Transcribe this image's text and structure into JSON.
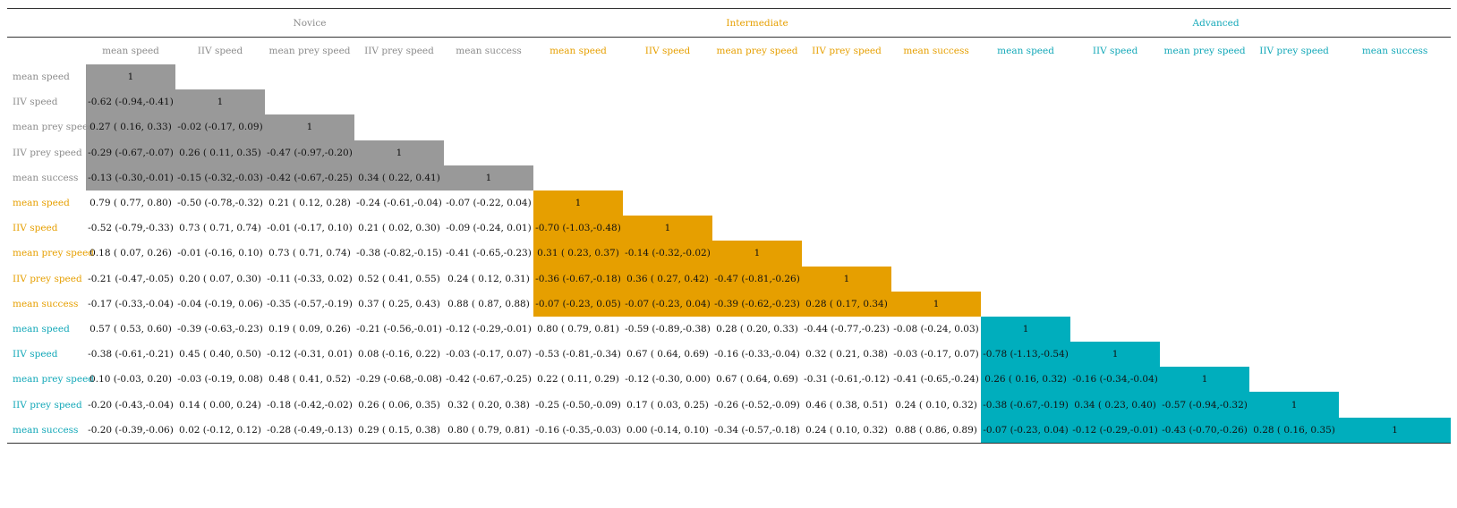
{
  "colors": {
    "novice": "#8c8c8c",
    "intermediate": "#e69f00",
    "advanced": "#13a8b8",
    "novice_bg": "#999999",
    "intermediate_bg": "#e69f00",
    "advanced_bg": "#00aebd"
  },
  "groups": [
    "Novice",
    "Intermediate",
    "Advanced"
  ],
  "columns": [
    [
      "mean speed",
      "IIV speed",
      "mean prey speed",
      "IIV prey speed",
      "mean success"
    ],
    [
      "mean speed",
      "IIV speed",
      "mean prey speed",
      "IIV prey speed",
      "mean success"
    ],
    [
      "mean speed",
      "IIV speed",
      "mean prey speed",
      "IIV prey speed",
      "mean success"
    ]
  ],
  "rows": [
    {
      "group": 0,
      "label": "mean speed",
      "cells": [
        "1"
      ]
    },
    {
      "group": 0,
      "label": "IIV speed",
      "cells": [
        "-0.62 (-0.94,-0.41)",
        "1"
      ]
    },
    {
      "group": 0,
      "label": "mean prey speed",
      "cells": [
        "0.27 ( 0.16, 0.33)",
        "-0.02 (-0.17, 0.09)",
        "1"
      ]
    },
    {
      "group": 0,
      "label": "IIV prey speed",
      "cells": [
        "-0.29 (-0.67,-0.07)",
        "0.26 ( 0.11, 0.35)",
        "-0.47 (-0.97,-0.20)",
        "1"
      ]
    },
    {
      "group": 0,
      "label": "mean success",
      "cells": [
        "-0.13 (-0.30,-0.01)",
        "-0.15 (-0.32,-0.03)",
        "-0.42 (-0.67,-0.25)",
        "0.34 ( 0.22, 0.41)",
        "1"
      ]
    },
    {
      "group": 1,
      "label": "mean speed",
      "cells": [
        "0.79 ( 0.77, 0.80)",
        "-0.50 (-0.78,-0.32)",
        "0.21 ( 0.12, 0.28)",
        "-0.24 (-0.61,-0.04)",
        "-0.07 (-0.22, 0.04)",
        "1"
      ]
    },
    {
      "group": 1,
      "label": "IIV speed",
      "cells": [
        "-0.52 (-0.79,-0.33)",
        "0.73 ( 0.71, 0.74)",
        "-0.01 (-0.17, 0.10)",
        "0.21 ( 0.02, 0.30)",
        "-0.09 (-0.24, 0.01)",
        "-0.70 (-1.03,-0.48)",
        "1"
      ]
    },
    {
      "group": 1,
      "label": "mean prey speed",
      "cells": [
        "0.18 ( 0.07, 0.26)",
        "-0.01 (-0.16, 0.10)",
        "0.73 ( 0.71, 0.74)",
        "-0.38 (-0.82,-0.15)",
        "-0.41 (-0.65,-0.23)",
        "0.31 ( 0.23, 0.37)",
        "-0.14 (-0.32,-0.02)",
        "1"
      ]
    },
    {
      "group": 1,
      "label": "IIV prey speed",
      "cells": [
        "-0.21 (-0.47,-0.05)",
        "0.20 ( 0.07, 0.30)",
        "-0.11 (-0.33, 0.02)",
        "0.52 ( 0.41, 0.55)",
        "0.24 ( 0.12, 0.31)",
        "-0.36 (-0.67,-0.18)",
        "0.36 ( 0.27, 0.42)",
        "-0.47 (-0.81,-0.26)",
        "1"
      ]
    },
    {
      "group": 1,
      "label": "mean success",
      "cells": [
        "-0.17 (-0.33,-0.04)",
        "-0.04 (-0.19, 0.06)",
        "-0.35 (-0.57,-0.19)",
        "0.37 ( 0.25, 0.43)",
        "0.88 ( 0.87, 0.88)",
        "-0.07 (-0.23, 0.05)",
        "-0.07 (-0.23, 0.04)",
        "-0.39 (-0.62,-0.23)",
        "0.28 ( 0.17, 0.34)",
        "1"
      ]
    },
    {
      "group": 2,
      "label": "mean speed",
      "cells": [
        "0.57 ( 0.53, 0.60)",
        "-0.39 (-0.63,-0.23)",
        "0.19 ( 0.09, 0.26)",
        "-0.21 (-0.56,-0.01)",
        "-0.12 (-0.29,-0.01)",
        "0.80 ( 0.79, 0.81)",
        "-0.59 (-0.89,-0.38)",
        "0.28 ( 0.20, 0.33)",
        "-0.44 (-0.77,-0.23)",
        "-0.08 (-0.24, 0.03)",
        "1"
      ]
    },
    {
      "group": 2,
      "label": "IIV speed",
      "cells": [
        "-0.38 (-0.61,-0.21)",
        "0.45 ( 0.40, 0.50)",
        "-0.12 (-0.31, 0.01)",
        "0.08 (-0.16, 0.22)",
        "-0.03 (-0.17, 0.07)",
        "-0.53 (-0.81,-0.34)",
        "0.67 ( 0.64, 0.69)",
        "-0.16 (-0.33,-0.04)",
        "0.32 ( 0.21, 0.38)",
        "-0.03 (-0.17, 0.07)",
        "-0.78 (-1.13,-0.54)",
        "1"
      ]
    },
    {
      "group": 2,
      "label": "mean prey speed",
      "cells": [
        "0.10 (-0.03, 0.20)",
        "-0.03 (-0.19, 0.08)",
        "0.48 ( 0.41, 0.52)",
        "-0.29 (-0.68,-0.08)",
        "-0.42 (-0.67,-0.25)",
        "0.22 ( 0.11, 0.29)",
        "-0.12 (-0.30, 0.00)",
        "0.67 ( 0.64, 0.69)",
        "-0.31 (-0.61,-0.12)",
        "-0.41 (-0.65,-0.24)",
        "0.26 ( 0.16, 0.32)",
        "-0.16 (-0.34,-0.04)",
        "1"
      ]
    },
    {
      "group": 2,
      "label": "IIV prey speed",
      "cells": [
        "-0.20 (-0.43,-0.04)",
        "0.14 ( 0.00, 0.24)",
        "-0.18 (-0.42,-0.02)",
        "0.26 ( 0.06, 0.35)",
        "0.32 ( 0.20, 0.38)",
        "-0.25 (-0.50,-0.09)",
        "0.17 ( 0.03, 0.25)",
        "-0.26 (-0.52,-0.09)",
        "0.46 ( 0.38, 0.51)",
        "0.24 ( 0.10, 0.32)",
        "-0.38 (-0.67,-0.19)",
        "0.34 ( 0.23, 0.40)",
        "-0.57 (-0.94,-0.32)",
        "1"
      ]
    },
    {
      "group": 2,
      "label": "mean success",
      "cells": [
        "-0.20 (-0.39,-0.06)",
        "0.02 (-0.12, 0.12)",
        "-0.28 (-0.49,-0.13)",
        "0.29 ( 0.15, 0.38)",
        "0.80 ( 0.79, 0.81)",
        "-0.16 (-0.35,-0.03)",
        "0.00 (-0.14, 0.10)",
        "-0.34 (-0.57,-0.18)",
        "0.24 ( 0.10, 0.32)",
        "0.88 ( 0.86, 0.89)",
        "-0.07 (-0.23, 0.04)",
        "-0.12 (-0.29,-0.01)",
        "-0.43 (-0.70,-0.26)",
        "0.28 ( 0.16, 0.35)",
        "1"
      ]
    }
  ]
}
